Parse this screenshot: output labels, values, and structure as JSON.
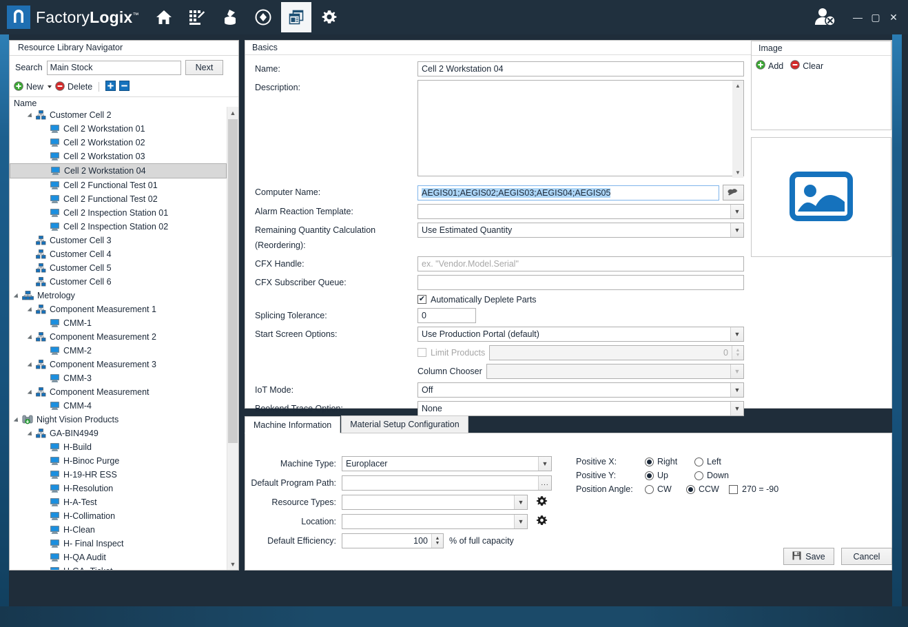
{
  "titlebar": {
    "brand_prefix": "Factory",
    "brand_suffix": "Logix",
    "brand_tm": "™",
    "nav_items": [
      {
        "name": "home-icon",
        "label": "Home"
      },
      {
        "name": "process-editor-icon",
        "label": "Process Editor"
      },
      {
        "name": "materials-icon",
        "label": "Materials"
      },
      {
        "name": "logistics-icon",
        "label": "Logistics"
      },
      {
        "name": "resource-library-icon",
        "label": "Resource Library",
        "active": true
      },
      {
        "name": "settings-gear-icon",
        "label": "Settings"
      }
    ],
    "window_controls": {
      "minimize": "—",
      "maximize": "▢",
      "close": "✕"
    }
  },
  "navigator": {
    "header": "Resource Library Navigator",
    "search_label": "Search",
    "search_value": "Main Stock",
    "search_placeholder": "",
    "next_label": "Next",
    "new_label": "New",
    "delete_label": "Delete",
    "expand_all_label": "Expand All",
    "collapse_all_label": "Collapse All",
    "column_header": "Name",
    "tree": [
      {
        "label": "Customer Cell 2",
        "indent": 2,
        "icon": "cell-icon",
        "expander": "open",
        "selected": false
      },
      {
        "label": "Cell 2 Workstation 01",
        "indent": 3,
        "icon": "workstation-icon",
        "expander": "none",
        "selected": false
      },
      {
        "label": "Cell 2 Workstation 02",
        "indent": 3,
        "icon": "workstation-icon",
        "expander": "none",
        "selected": false
      },
      {
        "label": "Cell 2 Workstation 03",
        "indent": 3,
        "icon": "workstation-icon",
        "expander": "none",
        "selected": false
      },
      {
        "label": "Cell 2 Workstation 04",
        "indent": 3,
        "icon": "workstation-icon",
        "expander": "none",
        "selected": true
      },
      {
        "label": "Cell 2 Functional Test 01",
        "indent": 3,
        "icon": "workstation-icon",
        "expander": "none",
        "selected": false
      },
      {
        "label": "Cell 2 Functional Test 02",
        "indent": 3,
        "icon": "workstation-icon",
        "expander": "none",
        "selected": false
      },
      {
        "label": "Cell 2 Inspection Station 01",
        "indent": 3,
        "icon": "workstation-icon",
        "expander": "none",
        "selected": false
      },
      {
        "label": "Cell 2 Inspection Station 02",
        "indent": 3,
        "icon": "workstation-icon",
        "expander": "none",
        "selected": false
      },
      {
        "label": "Customer Cell 3",
        "indent": 2,
        "icon": "cell-icon",
        "expander": "none",
        "selected": false
      },
      {
        "label": "Customer Cell 4",
        "indent": 2,
        "icon": "cell-icon",
        "expander": "none",
        "selected": false
      },
      {
        "label": "Customer Cell 5",
        "indent": 2,
        "icon": "cell-icon",
        "expander": "none",
        "selected": false
      },
      {
        "label": "Customer Cell 6",
        "indent": 2,
        "icon": "cell-icon",
        "expander": "none",
        "selected": false
      },
      {
        "label": "Metrology",
        "indent": 1,
        "icon": "group-icon",
        "expander": "open",
        "selected": false
      },
      {
        "label": "Component Measurement 1",
        "indent": 2,
        "icon": "cell-icon",
        "expander": "open",
        "selected": false
      },
      {
        "label": "CMM-1",
        "indent": 3,
        "icon": "workstation-icon",
        "expander": "none",
        "selected": false
      },
      {
        "label": "Component Measurement 2",
        "indent": 2,
        "icon": "cell-icon",
        "expander": "open",
        "selected": false
      },
      {
        "label": "CMM-2",
        "indent": 3,
        "icon": "workstation-icon",
        "expander": "none",
        "selected": false
      },
      {
        "label": "Component Measurement 3",
        "indent": 2,
        "icon": "cell-icon",
        "expander": "open",
        "selected": false
      },
      {
        "label": "CMM-3",
        "indent": 3,
        "icon": "workstation-icon",
        "expander": "none",
        "selected": false
      },
      {
        "label": "Component Measurement",
        "indent": 2,
        "icon": "cell-icon",
        "expander": "open",
        "selected": false
      },
      {
        "label": "CMM-4",
        "indent": 3,
        "icon": "workstation-icon",
        "expander": "none",
        "selected": false
      },
      {
        "label": "Night Vision Products",
        "indent": 1,
        "icon": "binoculars-icon",
        "expander": "open",
        "selected": false
      },
      {
        "label": "GA-BIN4949",
        "indent": 2,
        "icon": "cell-icon",
        "expander": "open",
        "selected": false
      },
      {
        "label": "H-Build",
        "indent": 3,
        "icon": "workstation-icon",
        "expander": "none",
        "selected": false
      },
      {
        "label": "H-Binoc Purge",
        "indent": 3,
        "icon": "workstation-icon",
        "expander": "none",
        "selected": false
      },
      {
        "label": "H-19-HR ESS",
        "indent": 3,
        "icon": "workstation-icon",
        "expander": "none",
        "selected": false
      },
      {
        "label": "H-Resolution",
        "indent": 3,
        "icon": "workstation-icon",
        "expander": "none",
        "selected": false
      },
      {
        "label": "H-A-Test",
        "indent": 3,
        "icon": "workstation-icon",
        "expander": "none",
        "selected": false
      },
      {
        "label": "H-Collimation",
        "indent": 3,
        "icon": "workstation-icon",
        "expander": "none",
        "selected": false
      },
      {
        "label": "H-Clean",
        "indent": 3,
        "icon": "workstation-icon",
        "expander": "none",
        "selected": false
      },
      {
        "label": "H- Final Inspect",
        "indent": 3,
        "icon": "workstation-icon",
        "expander": "none",
        "selected": false
      },
      {
        "label": "H-QA Audit",
        "indent": 3,
        "icon": "workstation-icon",
        "expander": "none",
        "selected": false
      },
      {
        "label": "H-GA- Ticket",
        "indent": 3,
        "icon": "workstation-icon",
        "expander": "none",
        "selected": false
      }
    ]
  },
  "basics": {
    "group_title": "Basics",
    "name_label": "Name:",
    "name_value": "Cell 2 Workstation 04",
    "description_label": "Description:",
    "description_value": "",
    "computer_name_label": "Computer Name:",
    "computer_name_value": "AEGIS01;AEGIS02;AEGIS03;AEGIS04;AEGIS05",
    "computer_name_browse": "browse-network-icon",
    "alarm_label": "Alarm Reaction Template:",
    "alarm_value": "",
    "remaining_qty_label": "Remaining Quantity Calculation (Reordering):",
    "remaining_qty_value": "Use Estimated Quantity",
    "cfx_handle_label": "CFX Handle:",
    "cfx_handle_value": "",
    "cfx_handle_placeholder": "ex. \"Vendor.Model.Serial\"",
    "cfx_queue_label": "CFX Subscriber Queue:",
    "cfx_queue_value": "",
    "auto_deplete_label": "Automatically Deplete Parts",
    "auto_deplete_checked": true,
    "splicing_label": "Splicing Tolerance:",
    "splicing_value": "0",
    "start_screen_label": "Start Screen Options:",
    "start_screen_value": "Use Production Portal (default)",
    "limit_products_label": "Limit Products",
    "limit_products_checked": false,
    "limit_products_value": "0",
    "column_chooser_label": "Column Chooser",
    "column_chooser_value": "",
    "iot_mode_label": "IoT Mode:",
    "iot_mode_value": "Off",
    "bookend_label": "Bookend Trace Option:",
    "bookend_value": "None"
  },
  "image_panel": {
    "header": "Image",
    "add_label": "Add",
    "clear_label": "Clear",
    "placeholder_icon": "image-placeholder-icon",
    "accent_color": "#1572bd"
  },
  "tabs": {
    "items": [
      {
        "label": "Machine Information",
        "active": true
      },
      {
        "label": "Material Setup Configuration",
        "active": false
      }
    ],
    "machine_information": {
      "machine_type_label": "Machine Type:",
      "machine_type_value": "Europlacer",
      "program_path_label": "Default Program Path:",
      "program_path_value": "",
      "program_path_browse": "...",
      "resource_types_label": "Resource Types:",
      "resource_types_value": "",
      "location_label": "Location:",
      "location_value": "",
      "efficiency_label": "Default Efficiency:",
      "efficiency_value": "100",
      "efficiency_suffix": "% of full capacity",
      "positive_x_label": "Positive X:",
      "positive_x_options": [
        {
          "label": "Right",
          "selected": true
        },
        {
          "label": "Left",
          "selected": false
        }
      ],
      "positive_y_label": "Positive Y:",
      "positive_y_options": [
        {
          "label": "Up",
          "selected": true
        },
        {
          "label": "Down",
          "selected": false
        }
      ],
      "position_angle_label": "Position Angle:",
      "position_angle_options": [
        {
          "label": "CW",
          "selected": false
        },
        {
          "label": "CCW",
          "selected": true
        }
      ],
      "angle_270_label": "270 = -90",
      "angle_270_checked": false
    }
  },
  "footer": {
    "save_label": "Save",
    "save_icon": "floppy-disk-icon",
    "cancel_label": "Cancel"
  }
}
